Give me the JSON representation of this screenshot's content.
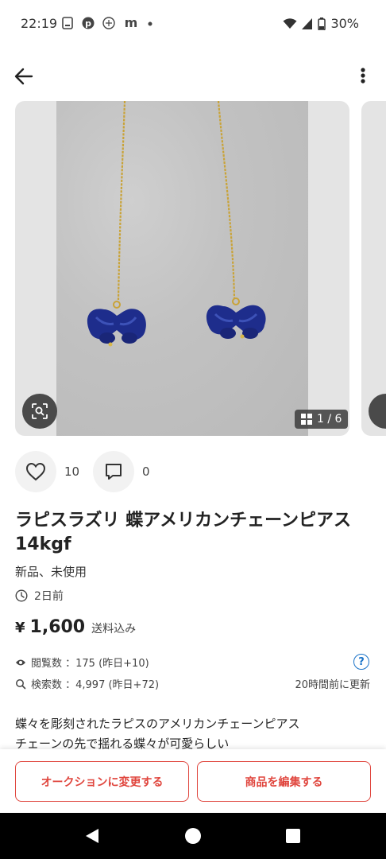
{
  "status_bar": {
    "time": "22:19",
    "battery": "30%"
  },
  "gallery": {
    "counter": "1 / 6"
  },
  "engagement": {
    "likes": "10",
    "comments": "0"
  },
  "item": {
    "title": "ラピスラズリ 蝶アメリカンチェーンピアス14kgf",
    "condition": "新品、未使用",
    "posted": "2日前",
    "currency": "¥",
    "price": "1,600",
    "shipping": "送料込み"
  },
  "stats": {
    "views": "閲覧数 ：175 (昨日+10)",
    "searches": "検索数 ：4,997 (昨日+72)",
    "updated": "20時間前に更新"
  },
  "description": {
    "line1": "蝶々を彫刻されたラピスのアメリカンチェーンピアス",
    "line2": "チェーンの先で揺れる蝶々が可愛らしい"
  },
  "actions": {
    "auction": "オークションに変更する",
    "edit": "商品を編集する"
  },
  "colors": {
    "accent": "#e0463e",
    "link": "#1a73c8"
  }
}
